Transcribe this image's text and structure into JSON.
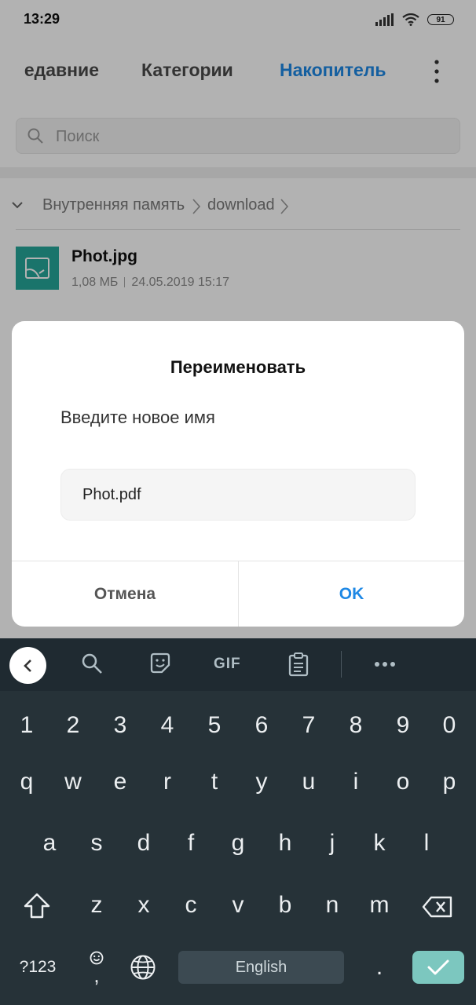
{
  "status_bar": {
    "time": "13:29",
    "battery": "91"
  },
  "tabs": {
    "recent": "Недавние",
    "categories": "Категории",
    "storage": "Накопитель"
  },
  "search": {
    "placeholder": "Поиск"
  },
  "breadcrumb": {
    "root": "Внутренняя память",
    "folder": "download"
  },
  "file": {
    "name": "Phot.jpg",
    "size": "1,08 МБ",
    "date": "24.05.2019 15:17"
  },
  "dialog": {
    "title": "Переименовать",
    "message": "Введите новое имя",
    "input_value": "Phot.pdf",
    "cancel": "Отмена",
    "ok": "OK"
  },
  "keyboard": {
    "toolbar_gif": "GIF",
    "row_numbers": [
      "1",
      "2",
      "3",
      "4",
      "5",
      "6",
      "7",
      "8",
      "9",
      "0"
    ],
    "row1": [
      "q",
      "w",
      "e",
      "r",
      "t",
      "y",
      "u",
      "i",
      "o",
      "p"
    ],
    "row2": [
      "a",
      "s",
      "d",
      "f",
      "g",
      "h",
      "j",
      "k",
      "l"
    ],
    "row3": [
      "z",
      "x",
      "c",
      "v",
      "b",
      "n",
      "m"
    ],
    "symbols_label": "?123",
    "comma": ",",
    "space_label": "English",
    "period": "."
  },
  "colors": {
    "accent": "#1e88e5",
    "keyboard_bg": "#263238",
    "enter": "#7cc7bf",
    "file_icon": "#26a69a"
  }
}
